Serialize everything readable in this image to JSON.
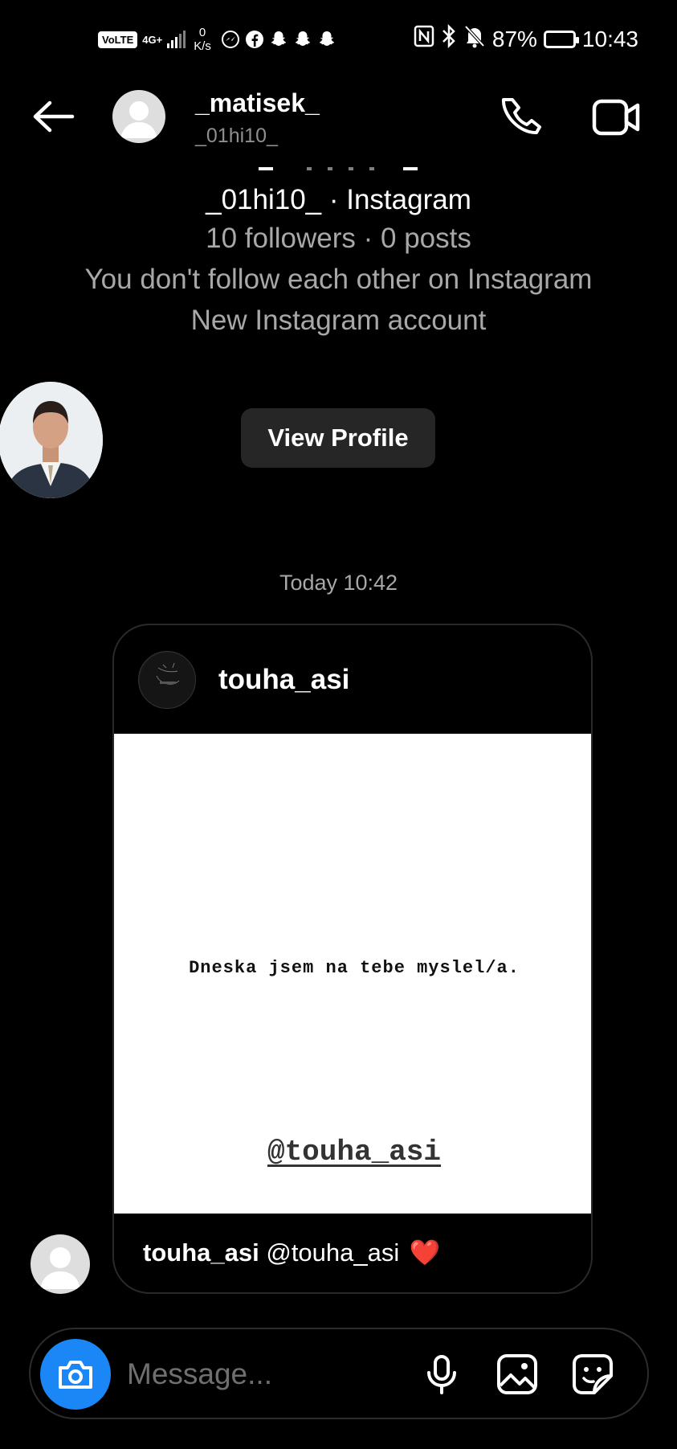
{
  "status_bar": {
    "volte": "VoLTE",
    "network": "4G+",
    "speed_value": "0",
    "speed_unit": "K/s",
    "battery": "87%",
    "battery_level": 0.87,
    "time": "10:43"
  },
  "header": {
    "name": "_matisek_",
    "username": "_01hi10_"
  },
  "profile": {
    "line1": "_01hi10_ · Instagram",
    "line2": "10 followers · 0 posts",
    "line3": "You don't follow each other on Instagram",
    "line4": "New Instagram account",
    "view_profile_label": "View Profile"
  },
  "thread": {
    "timestamp": "Today 10:42",
    "post": {
      "author": "touha_asi",
      "quote": "Dneska jsem na tebe myslel/a.",
      "mention": "@touha_asi",
      "caption_user": "touha_asi",
      "caption_text": "@touha_asi",
      "caption_emoji": "❤️"
    }
  },
  "composer": {
    "placeholder": "Message..."
  }
}
